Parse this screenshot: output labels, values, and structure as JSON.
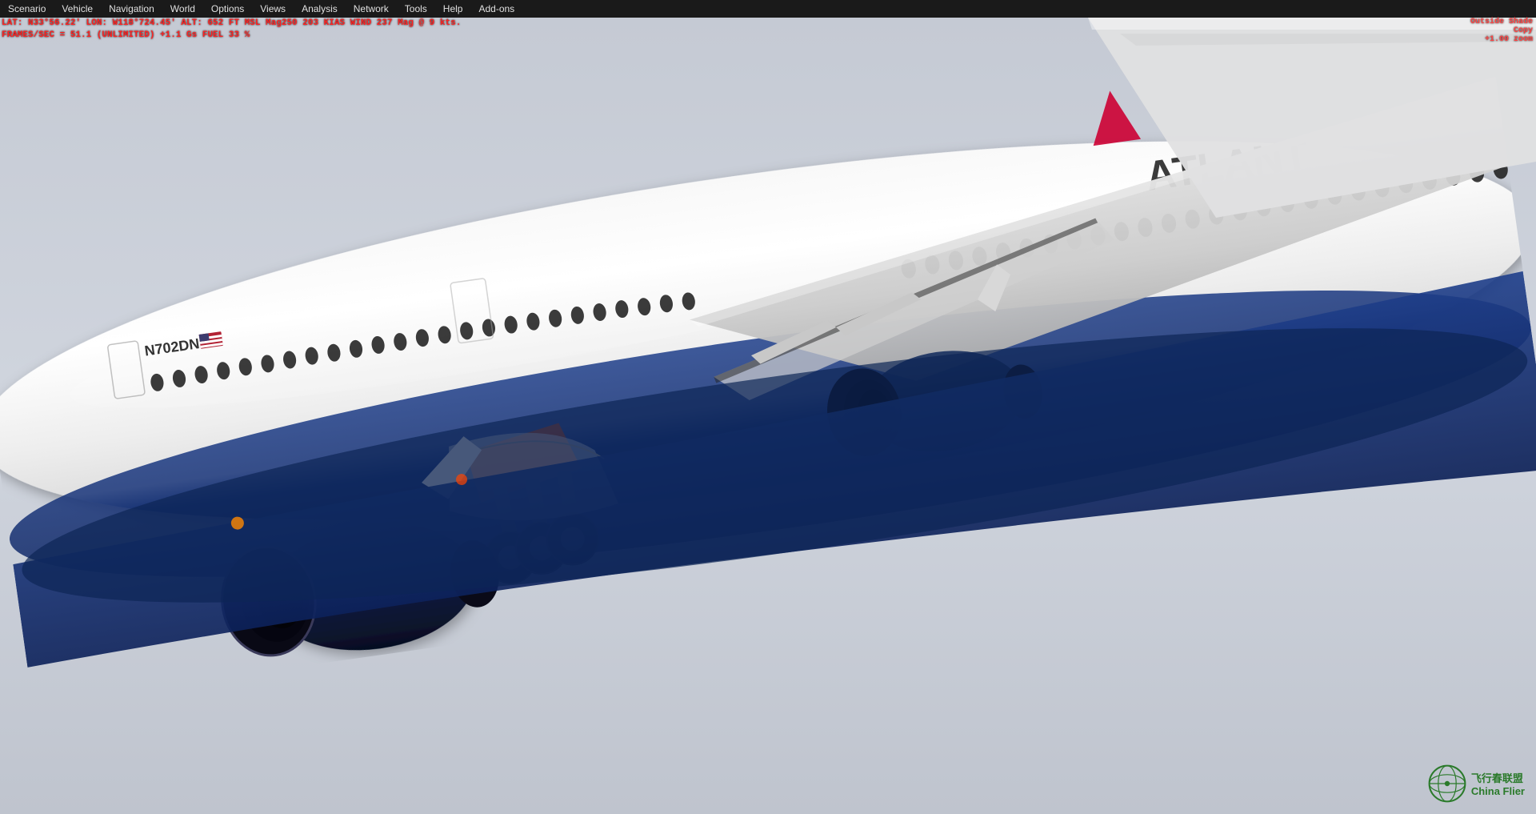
{
  "menubar": {
    "items": [
      {
        "id": "scenario",
        "label": "Scenario"
      },
      {
        "id": "vehicle",
        "label": "Vehicle"
      },
      {
        "id": "navigation",
        "label": "Navigation"
      },
      {
        "id": "world",
        "label": "World"
      },
      {
        "id": "options",
        "label": "Options"
      },
      {
        "id": "views",
        "label": "Views"
      },
      {
        "id": "analysis",
        "label": "Analysis"
      },
      {
        "id": "network",
        "label": "Network"
      },
      {
        "id": "tools",
        "label": "Tools"
      },
      {
        "id": "help",
        "label": "Help"
      },
      {
        "id": "addons",
        "label": "Add-ons"
      }
    ]
  },
  "hud": {
    "line1": "LAT: N33°56.22'  LON: W118°724.45'  ALT: 652 FT  MSL   Mag250  203 KIAS  WIND 237 Mag @ 9 kts.",
    "line2": "FRAMES/SEC = 51.1   (UNLIMITED)  +1.1 Gs  FUEL 33 %"
  },
  "top_right": {
    "line1": "Outside Shade",
    "line2": "Copy",
    "line3": "+1.00 zoom"
  },
  "aircraft": {
    "registration": "N702DN",
    "airline_text": "ATLANT",
    "airline_full": "ATLANTA"
  },
  "watermark": {
    "site": "飞行春联盟",
    "brand": "China Flier"
  }
}
